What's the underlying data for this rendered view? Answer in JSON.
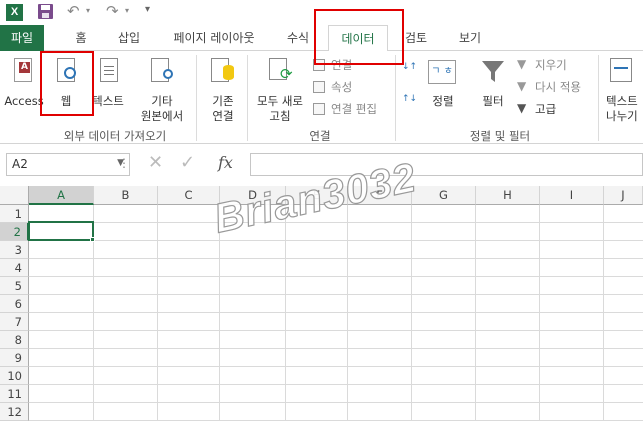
{
  "quick_access": {
    "excel_icon": "excel-logo",
    "save_icon": "save-icon",
    "undo_icon": "undo-icon",
    "redo_icon": "redo-icon",
    "customize_icon": "customize-qat-icon"
  },
  "tabs": [
    "파일",
    "홈",
    "삽입",
    "페이지 레이아웃",
    "수식",
    "데이터",
    "검토",
    "보기"
  ],
  "active_tab": "데이터",
  "ribbon": {
    "get_external": {
      "access": "Access",
      "web": "웹",
      "text": "텍스트",
      "other_line1": "기타",
      "other_line2": "원본에서",
      "group_label": "외부 데이터 가져오기"
    },
    "existing_line1": "기존",
    "existing_line2": "연결",
    "connections": {
      "refresh_line1": "모두 새로",
      "refresh_line2": "고침",
      "connections_item": "연결",
      "properties_item": "속성",
      "edit_links_item": "연결 편집",
      "group_label": "연결"
    },
    "sort_filter": {
      "sort": "정렬",
      "filter": "필터",
      "clear": "지우기",
      "reapply": "다시 적용",
      "advanced": "고급",
      "sort_az_icon": "ㄱ ㅎ",
      "group_label": "정렬 및 필터"
    },
    "text_to_cols_line1": "텍스트",
    "text_to_cols_line2": "나누기"
  },
  "formula_bar": {
    "name_box": "A2",
    "fx": "fx",
    "value": ""
  },
  "columns": [
    "A",
    "B",
    "C",
    "D",
    "E",
    "F",
    "G",
    "H",
    "I",
    "J"
  ],
  "rows": [
    "1",
    "2",
    "3",
    "4",
    "5",
    "6",
    "7",
    "8",
    "9",
    "10",
    "11",
    "12"
  ],
  "selected_cell": "A2",
  "watermark": "Brian3032",
  "colors": {
    "excel_green": "#217346",
    "highlight_red": "#e00000"
  }
}
